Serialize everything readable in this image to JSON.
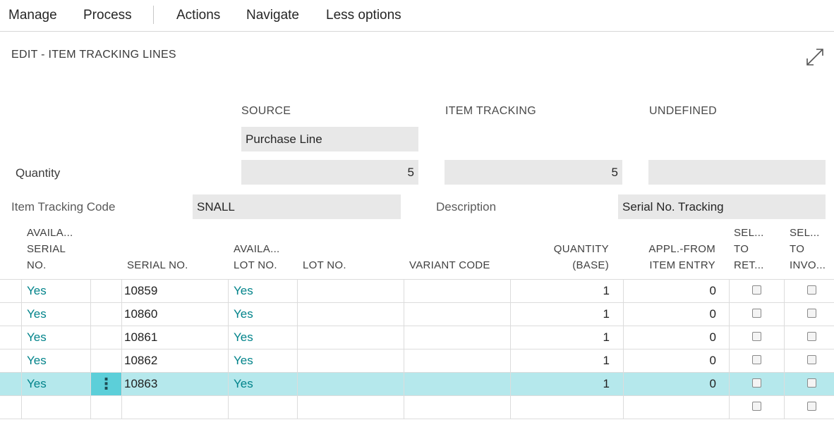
{
  "menu": {
    "items": [
      "Manage",
      "Process",
      "Actions",
      "Navigate",
      "Less options"
    ]
  },
  "page": {
    "title": "EDIT - ITEM TRACKING LINES",
    "expand_icon": "expand-icon"
  },
  "summary": {
    "headers": {
      "source": "SOURCE",
      "item_tracking": "ITEM TRACKING",
      "undefined": "UNDEFINED"
    },
    "source_value": "Purchase Line",
    "quantity_label": "Quantity",
    "quantity_source": "5",
    "quantity_item_tracking": "5",
    "quantity_undefined": "",
    "item_tracking_code_label": "Item Tracking Code",
    "item_tracking_code": "SNALL",
    "description_label": "Description",
    "description": "Serial No. Tracking"
  },
  "grid": {
    "headers": {
      "avail_serial": [
        "AVAILA...",
        "SERIAL",
        "NO."
      ],
      "serial_no": "SERIAL NO.",
      "avail_lot": [
        "AVAILA...",
        "LOT NO."
      ],
      "lot_no": "LOT NO.",
      "variant_code": "VARIANT CODE",
      "quantity_base": [
        "QUANTITY",
        "(BASE)"
      ],
      "appl_from": [
        "APPL.-FROM",
        "ITEM ENTRY"
      ],
      "sel_ret": [
        "SEL...",
        "TO",
        "RET..."
      ],
      "sel_inv": [
        "SEL...",
        "TO",
        "INVO..."
      ]
    },
    "rows": [
      {
        "avail_serial": "Yes",
        "serial_no": "10859",
        "avail_lot": "Yes",
        "lot_no": "",
        "variant_code": "",
        "quantity_base": "1",
        "appl_from": "0"
      },
      {
        "avail_serial": "Yes",
        "serial_no": "10860",
        "avail_lot": "Yes",
        "lot_no": "",
        "variant_code": "",
        "quantity_base": "1",
        "appl_from": "0"
      },
      {
        "avail_serial": "Yes",
        "serial_no": "10861",
        "avail_lot": "Yes",
        "lot_no": "",
        "variant_code": "",
        "quantity_base": "1",
        "appl_from": "0"
      },
      {
        "avail_serial": "Yes",
        "serial_no": "10862",
        "avail_lot": "Yes",
        "lot_no": "",
        "variant_code": "",
        "quantity_base": "1",
        "appl_from": "0"
      },
      {
        "avail_serial": "Yes",
        "serial_no": "10863",
        "avail_lot": "Yes",
        "lot_no": "",
        "variant_code": "",
        "quantity_base": "1",
        "appl_from": "0",
        "selected": true
      }
    ],
    "row_menu_icon": "more-vertical-icon",
    "selected_color": "#b5e8ec",
    "link_color": "#00838a"
  }
}
